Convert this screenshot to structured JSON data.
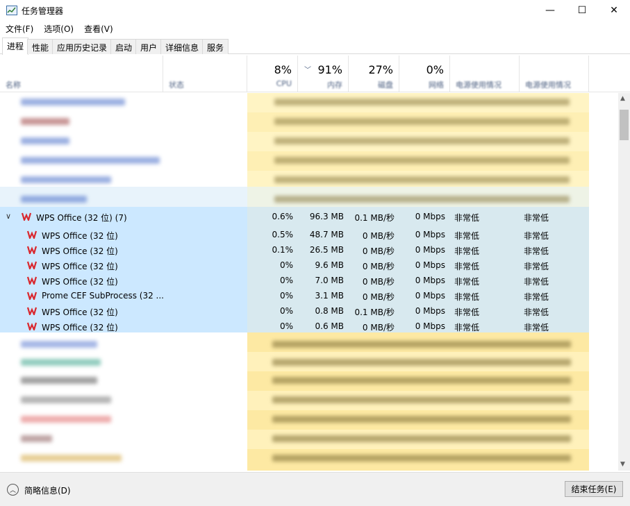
{
  "window": {
    "title": "任务管理器",
    "minimize_glyph": "—",
    "maximize_glyph": "☐",
    "close_glyph": "✕"
  },
  "menu": [
    "文件(F)",
    "选项(O)",
    "查看(V)"
  ],
  "tabs": [
    {
      "label": "进程",
      "active": true
    },
    {
      "label": "性能"
    },
    {
      "label": "应用历史记录"
    },
    {
      "label": "启动"
    },
    {
      "label": "用户"
    },
    {
      "label": "详细信息"
    },
    {
      "label": "服务"
    }
  ],
  "columns": {
    "name": "名称",
    "status": "状态",
    "cpu": {
      "pct": "8%",
      "label": "CPU"
    },
    "memory": {
      "pct": "91%",
      "label": "内存"
    },
    "disk": {
      "pct": "27%",
      "label": "磁盘"
    },
    "network": {
      "pct": "0%",
      "label": "网络"
    },
    "power": "电源使用情况",
    "power_trend": "电源使用情况"
  },
  "wps_group": {
    "parent": {
      "name": "WPS Office (32 位) (7)",
      "cpu": "0.6%",
      "memory": "96.3 MB",
      "disk": "0.1 MB/秒",
      "network": "0 Mbps",
      "power": "非常低",
      "power_trend": "非常低"
    },
    "children": [
      {
        "name": "WPS Office (32 位)",
        "cpu": "0.5%",
        "memory": "48.7 MB",
        "disk": "0 MB/秒",
        "network": "0 Mbps",
        "power": "非常低",
        "power_trend": "非常低"
      },
      {
        "name": "WPS Office (32 位)",
        "cpu": "0.1%",
        "memory": "26.5 MB",
        "disk": "0 MB/秒",
        "network": "0 Mbps",
        "power": "非常低",
        "power_trend": "非常低"
      },
      {
        "name": "WPS Office (32 位)",
        "cpu": "0%",
        "memory": "9.6 MB",
        "disk": "0 MB/秒",
        "network": "0 Mbps",
        "power": "非常低",
        "power_trend": "非常低"
      },
      {
        "name": "WPS Office (32 位)",
        "cpu": "0%",
        "memory": "7.0 MB",
        "disk": "0 MB/秒",
        "network": "0 Mbps",
        "power": "非常低",
        "power_trend": "非常低"
      },
      {
        "name": "Prome CEF SubProcess (32 ...",
        "cpu": "0%",
        "memory": "3.1 MB",
        "disk": "0 MB/秒",
        "network": "0 Mbps",
        "power": "非常低",
        "power_trend": "非常低"
      },
      {
        "name": "WPS Office (32 位)",
        "cpu": "0%",
        "memory": "0.8 MB",
        "disk": "0.1 MB/秒",
        "network": "0 Mbps",
        "power": "非常低",
        "power_trend": "非常低"
      },
      {
        "name": "WPS Office (32 位)",
        "cpu": "0%",
        "memory": "0.6 MB",
        "disk": "0 MB/秒",
        "network": "0 Mbps",
        "power": "非常低",
        "power_trend": "非常低"
      }
    ]
  },
  "footer": {
    "fewer_details": "简略信息(D)",
    "end_task": "结束任务(E)"
  },
  "colors": {
    "selection": "#cce8ff",
    "heat_light": "#fff4c4",
    "heat_mid": "#fde9a3",
    "wps_red": "#d9272e"
  }
}
